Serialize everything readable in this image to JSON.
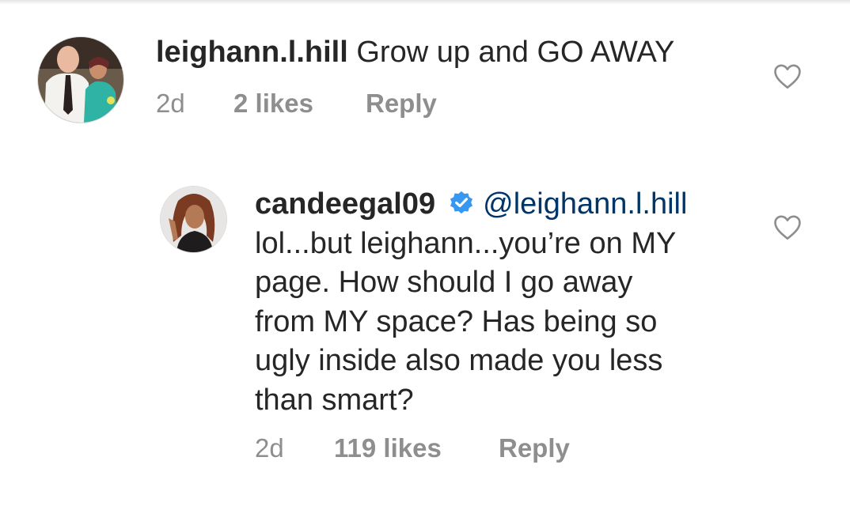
{
  "comments": [
    {
      "username": "leighann.l.hill",
      "text": " Grow up and  GO AWAY",
      "time": "2d",
      "likes": "2 likes",
      "reply_label": "Reply",
      "verified": false,
      "avatar_icon": "profile-photo"
    },
    {
      "username": "candeegal09",
      "mention": "@leighann.l.hill",
      "text_lines": [
        "lol...but leighann...you’re on MY",
        "page. How should I go away",
        "from MY space? Has being so",
        "ugly inside also made you less",
        "than smart?"
      ],
      "time": "2d",
      "likes": "119 likes",
      "reply_label": "Reply",
      "verified": true,
      "avatar_icon": "profile-photo"
    }
  ],
  "icons": {
    "like": "heart-outline-icon",
    "verified": "verified-badge-icon"
  },
  "colors": {
    "text": "#262626",
    "meta": "#8e8e8e",
    "mention": "#003569",
    "verified": "#3897f0"
  }
}
